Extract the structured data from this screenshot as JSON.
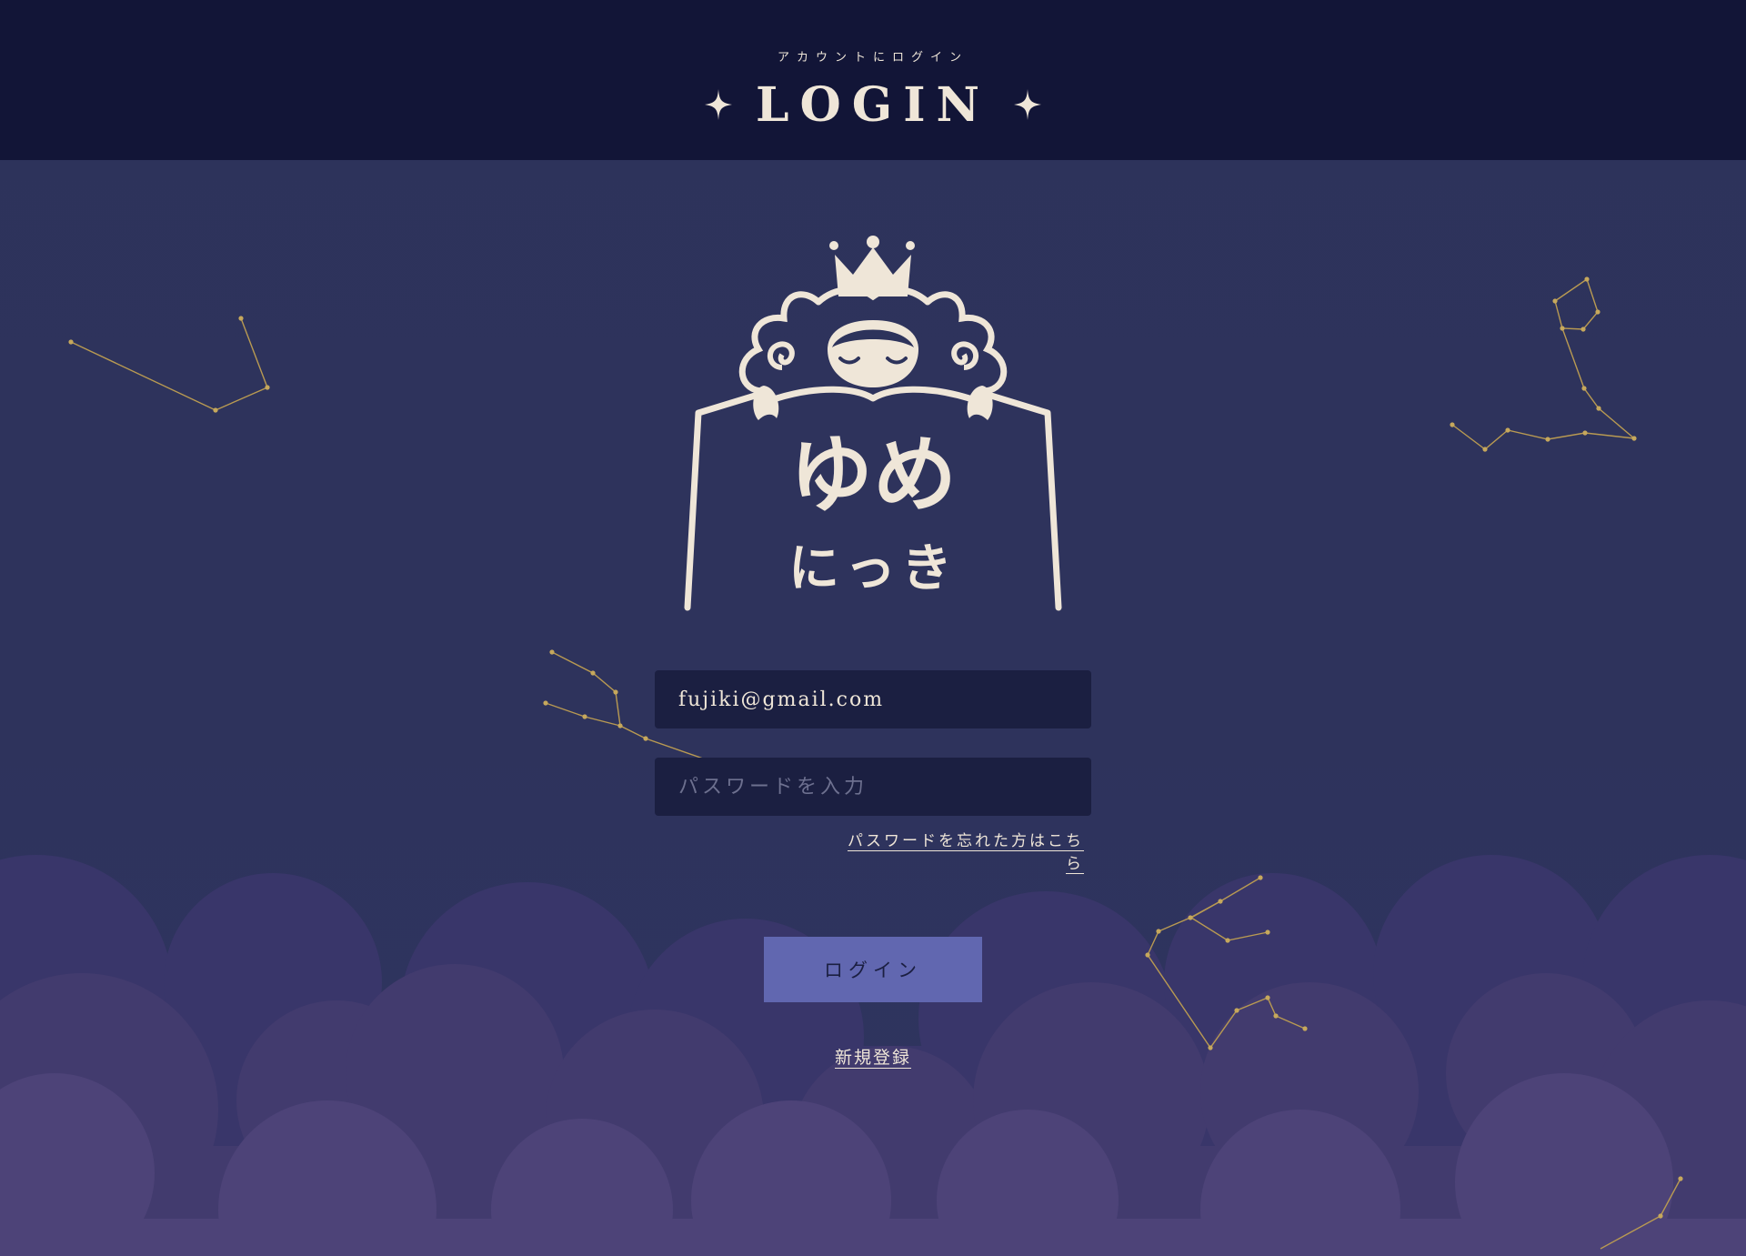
{
  "header": {
    "subtitle": "アカウントにログイン",
    "title": "LOGIN"
  },
  "logo": {
    "line1": "ゆめ",
    "line2": "にっき"
  },
  "form": {
    "email_value": "fujiki@gmail.com",
    "password_placeholder": "パスワードを入力",
    "forgot_label": "パスワードを忘れた方はこちら",
    "login_label": "ログイン",
    "register_label": "新規登録"
  },
  "colors": {
    "header_bg": "#121537",
    "body_bg": "#2d335b",
    "cream": "#efe6d8",
    "field_bg": "#1b1f41",
    "button_bg": "#6167b0",
    "constellation": "#b99a52",
    "cloud_far": "#3a3765",
    "cloud_mid": "#433c6f",
    "cloud_near": "#4e4478"
  },
  "icons": [
    "sparkle-icon",
    "constellation-icon",
    "sheep-princess-logo"
  ]
}
